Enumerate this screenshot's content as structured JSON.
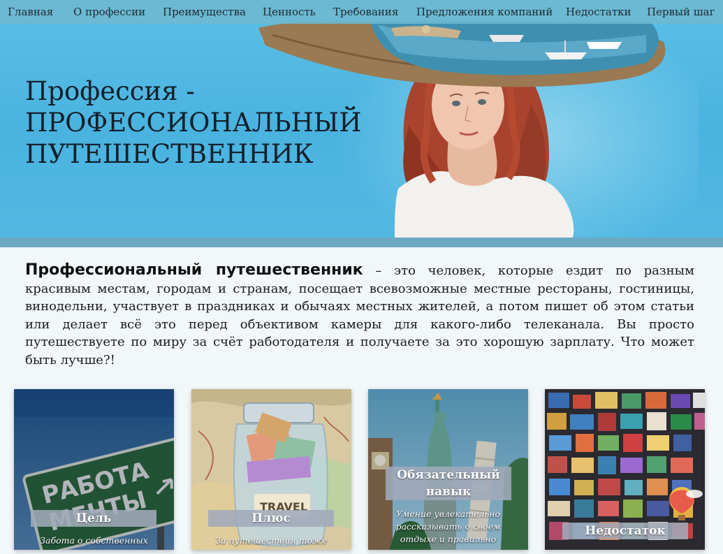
{
  "nav": {
    "items": [
      "Главная",
      "О профессии",
      "Преимущества",
      "Ценность",
      "Требования",
      "Предложения компаний",
      "Недостатки",
      "Первый шаг"
    ]
  },
  "hero": {
    "title_line1": "Профессия -",
    "title_line2": "ПРОФЕССИОНАЛЬНЫЙ",
    "title_line3": "ПУТЕШЕСТВЕННИК"
  },
  "intro": {
    "strong": "Профессиональный путешественник",
    "text": " – это человек, которые ездит по разным красивым местам, городам и странам, посещает всевозможные местные рестораны, гостиницы, винодельни, участвует в праздниках и обычаях местных жителей, а потом пишет об этом статьи или делает всё это перед объективом камеры для какого-либо телеканала. Вы просто путешествуете по миру за счёт работодателя и получаете за это хорошую зарплату. Что может быть лучше?!"
  },
  "cards": [
    {
      "label": "Цель",
      "caption": "Забота о собственных",
      "sign_text_1": "РАБОТА",
      "sign_text_2": "МЕЧТЫ"
    },
    {
      "label": "Плюс",
      "caption": "За путешествия тоже",
      "jar_text": "TRAVEL"
    },
    {
      "label_line1": "Обязательный",
      "label_line2": "навык",
      "caption_line1": "Умение увлекательно",
      "caption_line2": "рассказывать о своем",
      "caption_line3": "отдыхе и правильно"
    },
    {
      "label": "Недостаток"
    }
  ],
  "colors": {
    "nav_bg": "#6cb8d0",
    "hero_bg": "#52b8e2",
    "band": "#6aa9c1",
    "page_bg": "#f2f7fa"
  }
}
